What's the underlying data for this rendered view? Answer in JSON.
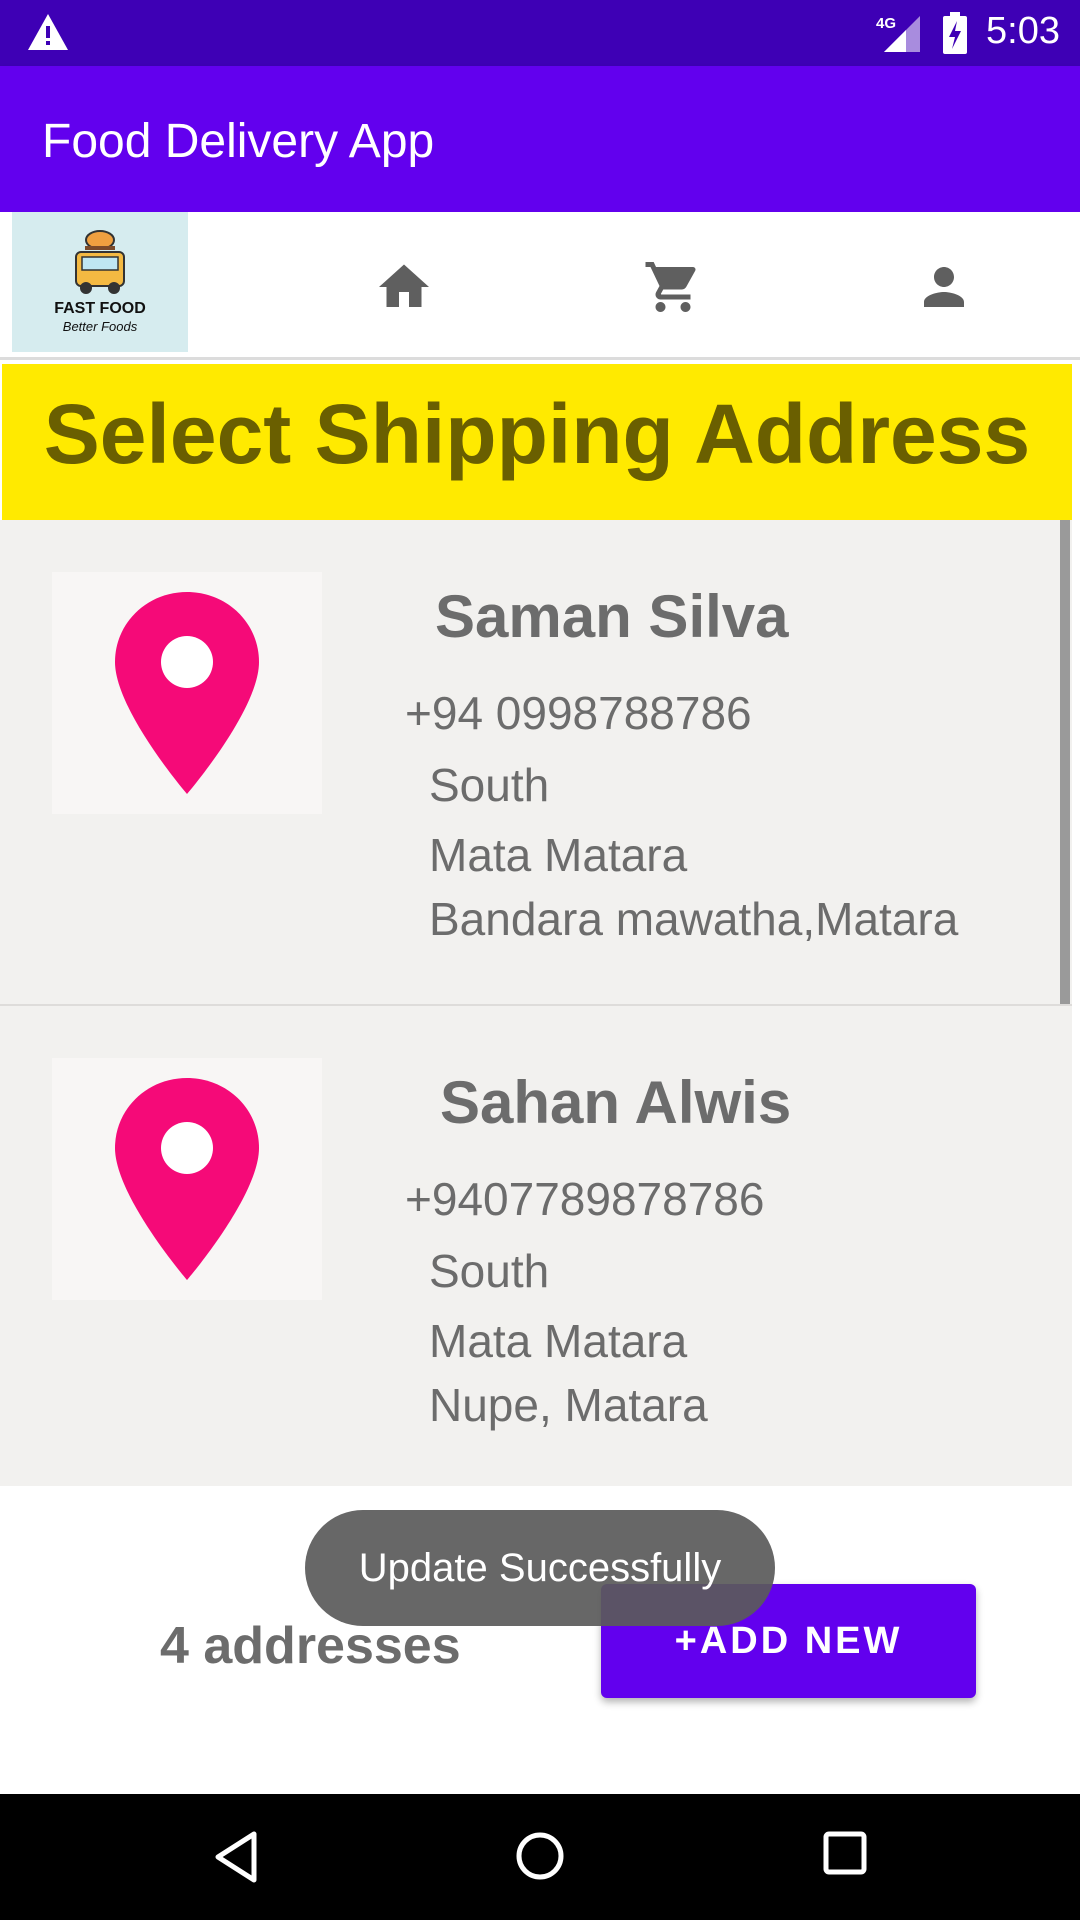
{
  "status_bar": {
    "network": "4G",
    "time": "5:03"
  },
  "app_bar": {
    "title": "Food Delivery App"
  },
  "logo": {
    "line1": "FAST FOOD",
    "line2": "Better Foods"
  },
  "nav_icons": [
    "home-icon",
    "cart-icon",
    "person-icon"
  ],
  "page_header": {
    "title": "Select Shipping Address"
  },
  "addresses": [
    {
      "name": "Saman Silva",
      "phone": "+94  0998788786",
      "province": "South",
      "city": "Mata Matara",
      "street": "Bandara mawatha,Matara"
    },
    {
      "name": "Sahan Alwis",
      "phone": "+9407789878786",
      "province": "South",
      "city": "Mata Matara",
      "street": "Nupe, Matara"
    }
  ],
  "footer": {
    "count": "4 addresses",
    "add_button": "+ADD NEW"
  },
  "toast": {
    "message": "Update Successfully"
  },
  "colors": {
    "primary": "#6200ee",
    "status_bar": "#3e00b5",
    "header_bg": "#ffea00",
    "pin": "#f50a78"
  }
}
